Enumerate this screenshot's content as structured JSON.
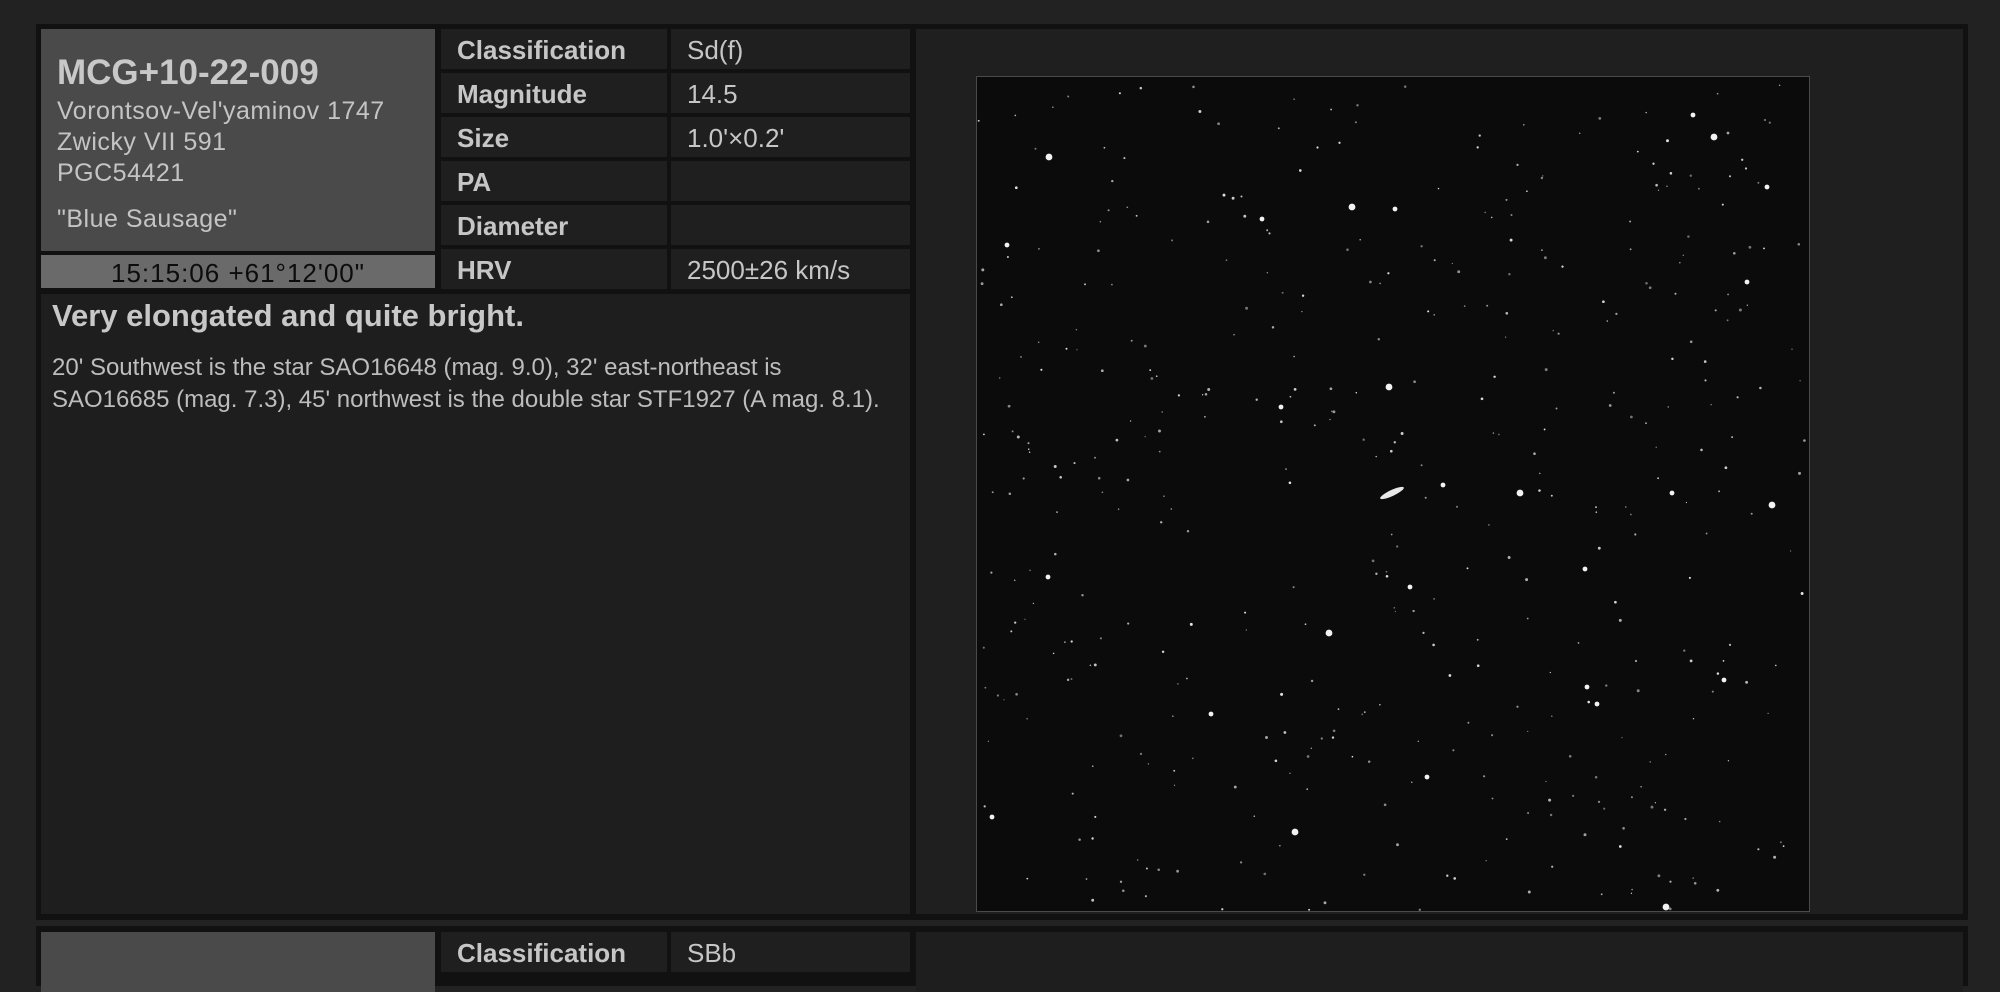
{
  "objects": [
    {
      "name": "MCG+10-22-009",
      "aliases": [
        "Vorontsov-Vel'yaminov 1747",
        "Zwicky VII 591",
        "PGC54421"
      ],
      "nickname": "\"Blue Sausage\"",
      "coordinates": "15:15:06 +61°12'00\"",
      "properties": [
        {
          "label": "Classification",
          "value": "Sd(f)"
        },
        {
          "label": "Magnitude",
          "value": "14.5"
        },
        {
          "label": "Size",
          "value": "1.0'×0.2'"
        },
        {
          "label": "PA",
          "value": ""
        },
        {
          "label": "Diameter",
          "value": ""
        },
        {
          "label": "HRV",
          "value": "2500±26 km/s"
        }
      ],
      "headline": "Very elongated and quite bright.",
      "description": "20' Southwest is the star SAO16648 (mag. 9.0), 32' east-northeast is SAO16685 (mag. 7.3), 45' northwest is the double star STF1927 (A mag. 8.1)."
    },
    {
      "properties": [
        {
          "label": "Classification",
          "value": "SBb"
        }
      ]
    }
  ],
  "colors": {
    "background": "#222222",
    "card_border": "#111111",
    "panel": "#1f1f1f",
    "name_box": "#4a4a4a",
    "coord_box": "#6a6a6a",
    "text": "#c6c6c6"
  },
  "icons": {
    "sky_image": "star-field-photo"
  }
}
